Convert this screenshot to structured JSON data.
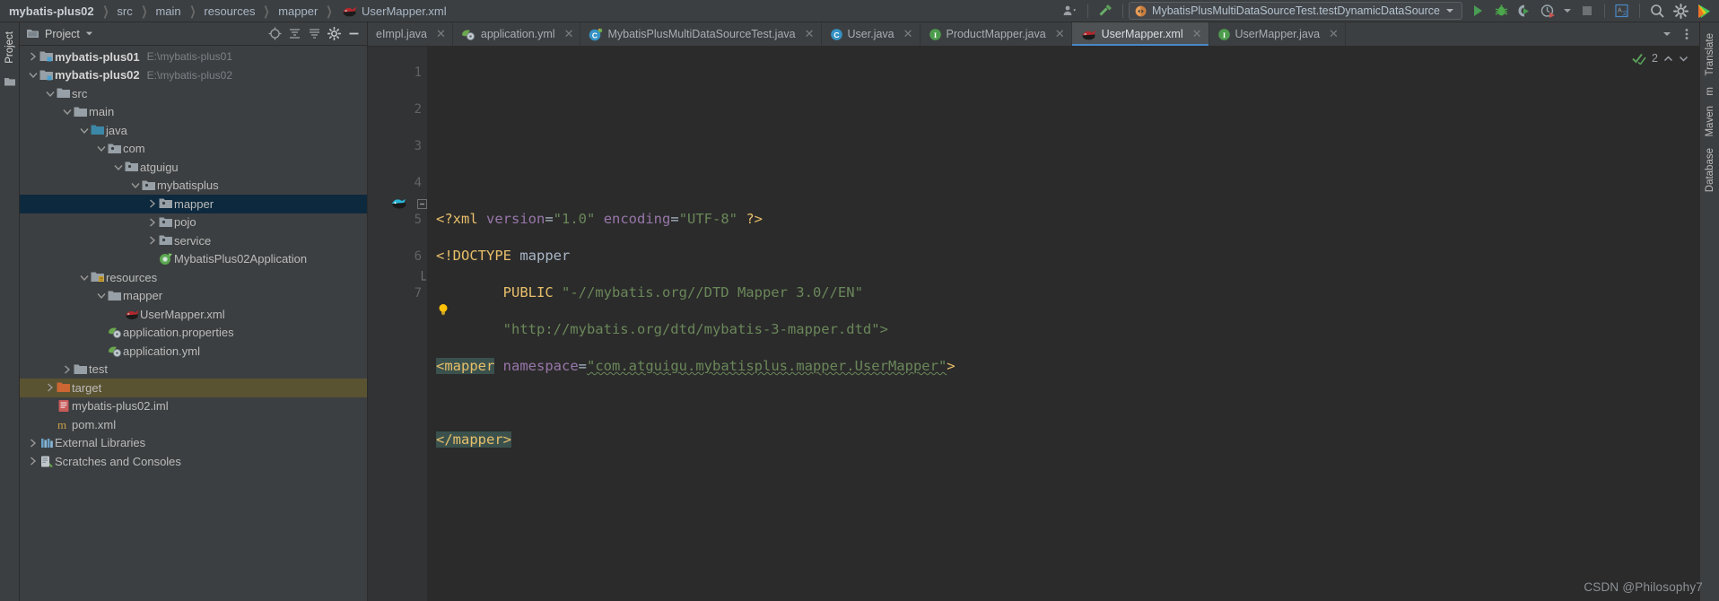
{
  "breadcrumbs": [
    {
      "label": "mybatis-plus02",
      "bold": true,
      "icon": null
    },
    {
      "label": "src",
      "bold": false,
      "icon": null
    },
    {
      "label": "main",
      "bold": false,
      "icon": null
    },
    {
      "label": "resources",
      "bold": false,
      "icon": null
    },
    {
      "label": "mapper",
      "bold": false,
      "icon": null
    },
    {
      "label": "UserMapper.xml",
      "bold": false,
      "icon": "mybatis-file-icon"
    }
  ],
  "toolbar": {
    "user_icon": "user-avatar-icon",
    "build_icon": "build-hammer-icon",
    "run_config": {
      "icon": "run-config-icon",
      "label": "MybatisPlusMultiDataSourceTest.testDynamicDataSource",
      "dropdown": "chevron-down-icon"
    },
    "actions": [
      {
        "name": "run-button",
        "icon": "play-icon",
        "color": "#499c54"
      },
      {
        "name": "debug-button",
        "icon": "bug-icon",
        "color": "#4ca64c"
      },
      {
        "name": "run-with-coverage-button",
        "icon": "coverage-icon",
        "color": "#9aa7b0"
      },
      {
        "name": "profiler-button",
        "icon": "profiler-icon",
        "color": "#c75450"
      },
      {
        "name": "profiler-dropdown",
        "icon": "chevron-down-icon",
        "color": "#9aa7b0"
      },
      {
        "name": "stop-button",
        "icon": "stop-square-icon",
        "color": "#6e7174"
      },
      {
        "name": "translate-button",
        "icon": "translate-icon",
        "color": "#4a88c7"
      },
      {
        "name": "search-everywhere-button",
        "icon": "search-icon",
        "color": "#b0b3b6"
      },
      {
        "name": "settings-button",
        "icon": "gear-icon",
        "color": "#b0b3b6"
      },
      {
        "name": "ide-logo",
        "icon": "intellij-logo-icon",
        "color": "#ffc20e"
      }
    ]
  },
  "left_strip": {
    "labels": [
      {
        "text": "Project",
        "active": true
      }
    ],
    "icons": [
      "structure-folder-icon"
    ]
  },
  "project_panel": {
    "title": "Project",
    "title_icon": "project-folder-icon",
    "title_dropdown": "chevron-down-icon",
    "header_buttons": [
      {
        "name": "select-opened-file-button",
        "icon": "target-crosshair-icon"
      },
      {
        "name": "expand-all-button",
        "icon": "expand-all-icon"
      },
      {
        "name": "collapse-all-button",
        "icon": "collapse-all-icon"
      },
      {
        "name": "panel-settings-button",
        "icon": "gear-icon"
      },
      {
        "name": "hide-panel-button",
        "icon": "minimize-icon"
      }
    ],
    "tree": [
      {
        "indent": 0,
        "arrow": "right",
        "icon": "module-folder-icon",
        "label": "mybatis-plus01",
        "bold": true,
        "path": "E:\\mybatis-plus01",
        "state": "none"
      },
      {
        "indent": 0,
        "arrow": "down",
        "icon": "module-folder-icon",
        "label": "mybatis-plus02",
        "bold": true,
        "path": "E:\\mybatis-plus02",
        "state": "none"
      },
      {
        "indent": 1,
        "arrow": "down",
        "icon": "folder-icon",
        "label": "src",
        "bold": false,
        "path": "",
        "state": "none"
      },
      {
        "indent": 2,
        "arrow": "down",
        "icon": "folder-icon",
        "label": "main",
        "bold": false,
        "path": "",
        "state": "none"
      },
      {
        "indent": 3,
        "arrow": "down",
        "icon": "source-root-icon",
        "label": "java",
        "bold": false,
        "path": "",
        "state": "none"
      },
      {
        "indent": 4,
        "arrow": "down",
        "icon": "package-icon",
        "label": "com",
        "bold": false,
        "path": "",
        "state": "none"
      },
      {
        "indent": 5,
        "arrow": "down",
        "icon": "package-icon",
        "label": "atguigu",
        "bold": false,
        "path": "",
        "state": "none"
      },
      {
        "indent": 6,
        "arrow": "down",
        "icon": "package-icon",
        "label": "mybatisplus",
        "bold": false,
        "path": "",
        "state": "none"
      },
      {
        "indent": 7,
        "arrow": "right",
        "icon": "package-icon",
        "label": "mapper",
        "bold": false,
        "path": "",
        "state": "selected-blue"
      },
      {
        "indent": 7,
        "arrow": "right",
        "icon": "package-icon",
        "label": "pojo",
        "bold": false,
        "path": "",
        "state": "none"
      },
      {
        "indent": 7,
        "arrow": "right",
        "icon": "package-icon",
        "label": "service",
        "bold": false,
        "path": "",
        "state": "none"
      },
      {
        "indent": 7,
        "arrow": "none",
        "icon": "spring-boot-icon",
        "label": "MybatisPlus02Application",
        "bold": false,
        "path": "",
        "state": "none"
      },
      {
        "indent": 3,
        "arrow": "down",
        "icon": "resources-root-icon",
        "label": "resources",
        "bold": false,
        "path": "",
        "state": "none"
      },
      {
        "indent": 4,
        "arrow": "down",
        "icon": "folder-icon",
        "label": "mapper",
        "bold": false,
        "path": "",
        "state": "none"
      },
      {
        "indent": 5,
        "arrow": "none",
        "icon": "mybatis-file-icon",
        "label": "UserMapper.xml",
        "bold": false,
        "path": "",
        "state": "none"
      },
      {
        "indent": 4,
        "arrow": "none",
        "icon": "spring-config-icon",
        "label": "application.properties",
        "bold": false,
        "path": "",
        "state": "none"
      },
      {
        "indent": 4,
        "arrow": "none",
        "icon": "spring-config-icon",
        "label": "application.yml",
        "bold": false,
        "path": "",
        "state": "none"
      },
      {
        "indent": 2,
        "arrow": "right",
        "icon": "folder-icon",
        "label": "test",
        "bold": false,
        "path": "",
        "state": "none"
      },
      {
        "indent": 1,
        "arrow": "right",
        "icon": "target-folder-icon",
        "label": "target",
        "bold": false,
        "path": "",
        "state": "selected-brown"
      },
      {
        "indent": 1,
        "arrow": "none",
        "icon": "iml-file-icon",
        "label": "mybatis-plus02.iml",
        "bold": false,
        "path": "",
        "state": "none"
      },
      {
        "indent": 1,
        "arrow": "none",
        "icon": "maven-pom-icon",
        "label": "pom.xml",
        "bold": false,
        "path": "",
        "state": "none"
      },
      {
        "indent": 0,
        "arrow": "right",
        "icon": "libraries-icon",
        "label": "External Libraries",
        "bold": false,
        "path": "",
        "state": "none"
      },
      {
        "indent": 0,
        "arrow": "right",
        "icon": "scratches-icon",
        "label": "Scratches and Consoles",
        "bold": false,
        "path": "",
        "state": "none"
      }
    ]
  },
  "editor_tabs": {
    "tabs": [
      {
        "label": "eImpl.java",
        "icon": null,
        "icon_color": "",
        "icon_letter": "",
        "active": false,
        "closable": true,
        "clipped": true
      },
      {
        "label": "application.yml",
        "icon": "spring-config-icon",
        "icon_color": "#6aa84f",
        "icon_letter": "",
        "active": false,
        "closable": true,
        "clipped": false
      },
      {
        "label": "MybatisPlusMultiDataSourceTest.java",
        "icon": "java-test-class-icon",
        "icon_color": "#3592c4",
        "icon_letter": "C",
        "active": false,
        "closable": true,
        "clipped": false
      },
      {
        "label": "User.java",
        "icon": "java-class-icon",
        "icon_color": "#3592c4",
        "icon_letter": "C",
        "active": false,
        "closable": true,
        "clipped": false
      },
      {
        "label": "ProductMapper.java",
        "icon": "java-interface-icon",
        "icon_color": "#4d9c4d",
        "icon_letter": "I",
        "active": false,
        "closable": true,
        "clipped": false
      },
      {
        "label": "UserMapper.xml",
        "icon": "mybatis-file-icon",
        "icon_color": "",
        "icon_letter": "",
        "active": true,
        "closable": true,
        "clipped": false
      },
      {
        "label": "UserMapper.java",
        "icon": "java-interface-icon",
        "icon_color": "#4d9c4d",
        "icon_letter": "I",
        "active": false,
        "closable": true,
        "clipped": false
      }
    ],
    "right_buttons": [
      {
        "name": "tab-list-dropdown",
        "icon": "chevron-down-icon"
      },
      {
        "name": "tab-options-menu",
        "icon": "more-vertical-icon"
      }
    ]
  },
  "editor": {
    "inspection": {
      "count": "2",
      "check_icon": "inspection-check-icon",
      "up_icon": "chevron-up-icon",
      "down_icon": "chevron-down-icon"
    },
    "line_numbers": [
      "1",
      "2",
      "3",
      "4",
      "5",
      "6",
      "7"
    ],
    "gutter_marks": [
      {
        "line": 5,
        "icon": "mybatis-gutter-icon"
      },
      {
        "line": 5,
        "icon": "fold-minus-icon"
      },
      {
        "line": 6,
        "icon": "intention-bulb-icon"
      },
      {
        "line": 7,
        "icon": "fold-end-icon"
      }
    ],
    "lines": [
      {
        "n": 1,
        "tokens": [
          {
            "t": "<?xml ",
            "c": "tag"
          },
          {
            "t": "version",
            "c": "attr-name"
          },
          {
            "t": "=",
            "c": "punct"
          },
          {
            "t": "\"1.0\"",
            "c": "str"
          },
          {
            "t": " ",
            "c": "plain"
          },
          {
            "t": "encoding",
            "c": "attr-name"
          },
          {
            "t": "=",
            "c": "punct"
          },
          {
            "t": "\"UTF-8\"",
            "c": "str"
          },
          {
            "t": " ?>",
            "c": "tag"
          }
        ]
      },
      {
        "n": 2,
        "tokens": [
          {
            "t": "<!DOCTYPE ",
            "c": "tag"
          },
          {
            "t": "mapper",
            "c": "plain"
          }
        ]
      },
      {
        "n": 3,
        "tokens": [
          {
            "t": "        ",
            "c": "plain"
          },
          {
            "t": "PUBLIC ",
            "c": "tag"
          },
          {
            "t": "\"-//mybatis.org//DTD Mapper 3.0//EN\"",
            "c": "str"
          }
        ]
      },
      {
        "n": 4,
        "tokens": [
          {
            "t": "        ",
            "c": "plain"
          },
          {
            "t": "\"http://mybatis.org/dtd/mybatis-3-mapper.dtd\">",
            "c": "str"
          }
        ]
      },
      {
        "n": 5,
        "tokens": [
          {
            "t": "<mapper",
            "c": "tag-hl"
          },
          {
            "t": " ",
            "c": "plain"
          },
          {
            "t": "namespace",
            "c": "attr-name"
          },
          {
            "t": "=",
            "c": "punct"
          },
          {
            "t": "\"com.atguigu.mybatisplus.mapper.UserMapper\"",
            "c": "str-squiggle"
          },
          {
            "t": ">",
            "c": "tag"
          }
        ]
      },
      {
        "n": 6,
        "tokens": []
      },
      {
        "n": 7,
        "tokens": [
          {
            "t": "</mapper>",
            "c": "tag-hl"
          }
        ]
      }
    ]
  },
  "right_strip": {
    "labels": [
      {
        "text": "Translate"
      },
      {
        "text": "m"
      },
      {
        "text": "Maven"
      },
      {
        "text": "Database"
      }
    ]
  },
  "watermark": "CSDN @Philosophy7",
  "colors": {
    "bg_panel": "#3c3f41",
    "bg_editor": "#2b2b2b",
    "bg_gutter": "#313335",
    "selection_blue": "#0d293e",
    "selection_brown": "#5a5331",
    "tag_orange": "#e8bf6a",
    "attr_purple": "#9876aa",
    "string_green": "#6a8759",
    "text_default": "#a9b7c6",
    "tag_highlight": "#3b514d",
    "tab_active": "#4e5254"
  }
}
